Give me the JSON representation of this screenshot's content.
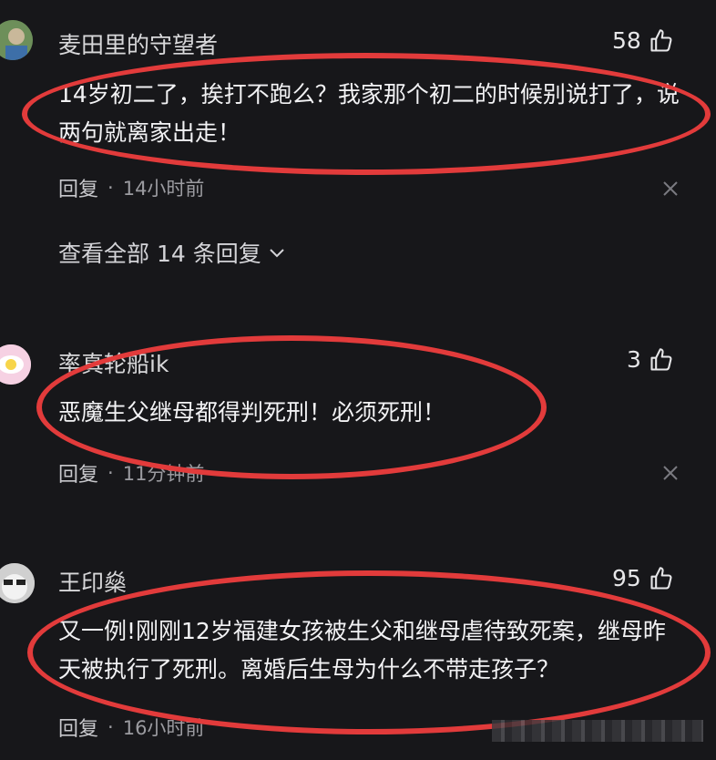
{
  "comments": [
    {
      "username": "麦田里的守望者",
      "likes": "58",
      "text": "14岁初二了，挨打不跑么？我家那个初二的时候别说打了，说两句就离家出走！",
      "reply_label": "回复",
      "separator": "·",
      "time": "14小时前",
      "view_all": "查看全部 14 条回复"
    },
    {
      "username": "率真轮船ik",
      "likes": "3",
      "text": "恶魔生父继母都得判死刑！必须死刑！",
      "reply_label": "回复",
      "separator": "·",
      "time": "11分钟前"
    },
    {
      "username": "王印燊",
      "likes": "95",
      "text": "又一例!刚刚12岁福建女孩被生父和继母虐待致死案，继母昨天被执行了死刑。离婚后生母为什么不带走孩子？",
      "reply_label": "回复",
      "separator": "·",
      "time": "16小时前"
    }
  ],
  "colors": {
    "background": "#17171a",
    "highlight_ellipse": "#e23b3b"
  },
  "icons": [
    "thumbs-up-icon",
    "close-icon",
    "chevron-down-icon"
  ]
}
